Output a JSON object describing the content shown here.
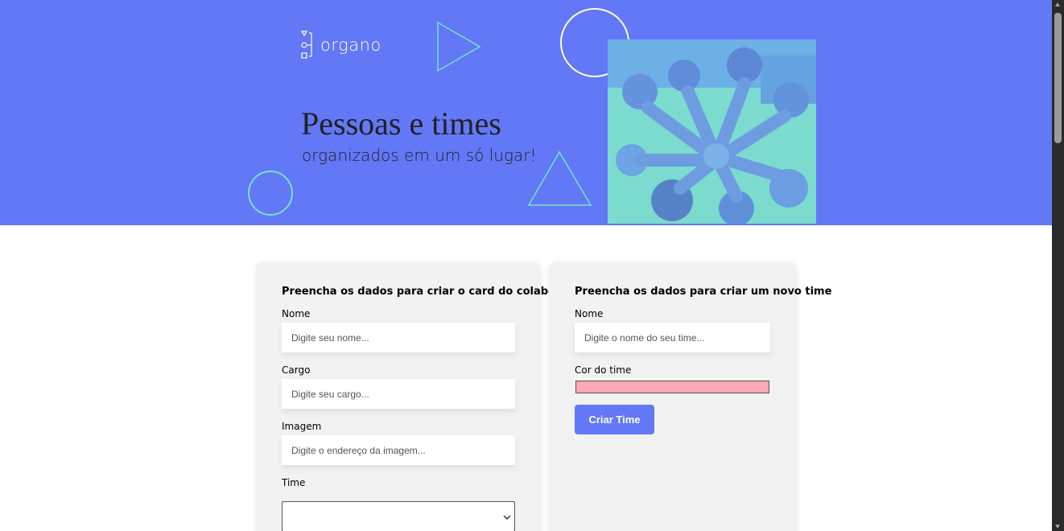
{
  "banner": {
    "logo_text": "organo",
    "title": "Pessoas e times",
    "subtitle": "organizados em um só lugar!",
    "background_color": "#6278f7",
    "photo_tint_color": "#74e3c8"
  },
  "collaborator_form": {
    "heading": "Preencha os dados para criar o card do colaborador",
    "fields": [
      {
        "label": "Nome",
        "placeholder": "Digite seu nome..."
      },
      {
        "label": "Cargo",
        "placeholder": "Digite seu cargo..."
      },
      {
        "label": "Imagem",
        "placeholder": "Digite o endereço da imagem..."
      }
    ],
    "team_label": "Time",
    "team_selected": ""
  },
  "team_form": {
    "heading": "Preencha os dados para criar um novo time",
    "name_label": "Nome",
    "name_placeholder": "Digite o nome do seu time...",
    "color_label": "Cor do time",
    "color_value": "#ffa8b8",
    "submit_label": "Criar Time"
  },
  "accent_color": "#6278f7"
}
